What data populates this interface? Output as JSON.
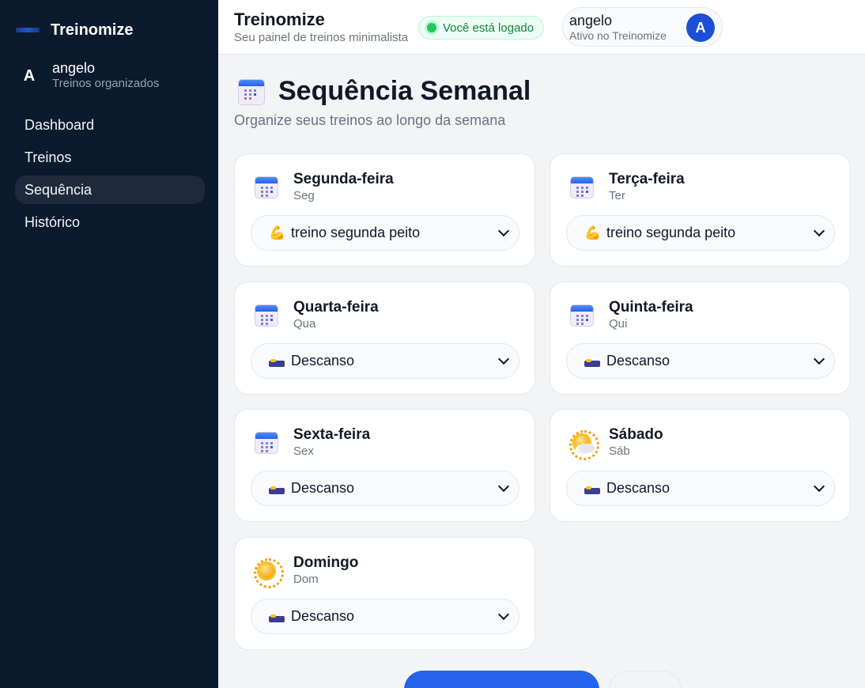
{
  "app": {
    "brand_name": "Treinomize"
  },
  "sidebar": {
    "user": {
      "avatar_initial": "A",
      "name": "angelo",
      "subtitle": "Treinos organizados"
    },
    "items": [
      {
        "label": "Dashboard",
        "active": false
      },
      {
        "label": "Treinos",
        "active": false
      },
      {
        "label": "Sequência",
        "active": true
      },
      {
        "label": "Histórico",
        "active": false
      }
    ]
  },
  "topbar": {
    "title": "Treinomize",
    "subtitle": "Seu painel de treinos minimalista",
    "status": "Você está logado",
    "user": {
      "name": "angelo",
      "status": "Ativo no Treinomize",
      "avatar_initial": "A"
    }
  },
  "page": {
    "icon": "calendar-icon",
    "title": "Sequência Semanal",
    "subtitle": "Organize seus treinos ao longo da semana"
  },
  "days": [
    {
      "name": "Segunda-feira",
      "abbr": "Seg",
      "icon": "calendar-icon",
      "selected": "treino segunda peito",
      "selected_icon": "flexed-biceps-icon"
    },
    {
      "name": "Terça-feira",
      "abbr": "Ter",
      "icon": "calendar-icon",
      "selected": "treino segunda peito",
      "selected_icon": "flexed-biceps-icon"
    },
    {
      "name": "Quarta-feira",
      "abbr": "Qua",
      "icon": "calendar-icon",
      "selected": "Descanso",
      "selected_icon": "bed-icon"
    },
    {
      "name": "Quinta-feira",
      "abbr": "Qui",
      "icon": "calendar-icon",
      "selected": "Descanso",
      "selected_icon": "bed-icon"
    },
    {
      "name": "Sexta-feira",
      "abbr": "Sex",
      "icon": "calendar-icon",
      "selected": "Descanso",
      "selected_icon": "bed-icon"
    },
    {
      "name": "Sábado",
      "abbr": "Sáb",
      "icon": "sun-behind-cloud-icon",
      "selected": "Descanso",
      "selected_icon": "bed-icon"
    },
    {
      "name": "Domingo",
      "abbr": "Dom",
      "icon": "sun-icon",
      "selected": "Descanso",
      "selected_icon": "bed-icon"
    }
  ],
  "colors": {
    "sidebar_bg": "#0c1a2e",
    "accent": "#2563eb",
    "status_green": "#22c55e"
  }
}
